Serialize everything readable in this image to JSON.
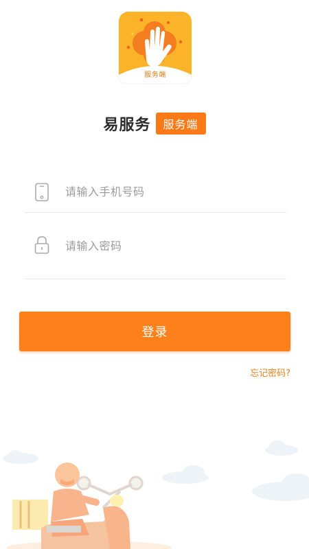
{
  "logo": {
    "caption": "服务端",
    "icon": "raised-hand-icon"
  },
  "header": {
    "app_name": "易服务",
    "role_badge": "服务端"
  },
  "form": {
    "phone": {
      "placeholder": "请输入手机号码",
      "value": "",
      "icon": "phone-icon"
    },
    "password": {
      "placeholder": "请输入密码",
      "value": "",
      "icon": "lock-icon"
    }
  },
  "actions": {
    "login_label": "登录",
    "forgot_label": "忘记密码?"
  },
  "illustration": {
    "subject": "delivery-rider-scooter"
  },
  "colors": {
    "accent": "#fd801a",
    "logo_bg": "#fbb42a",
    "link": "#e8801e"
  }
}
